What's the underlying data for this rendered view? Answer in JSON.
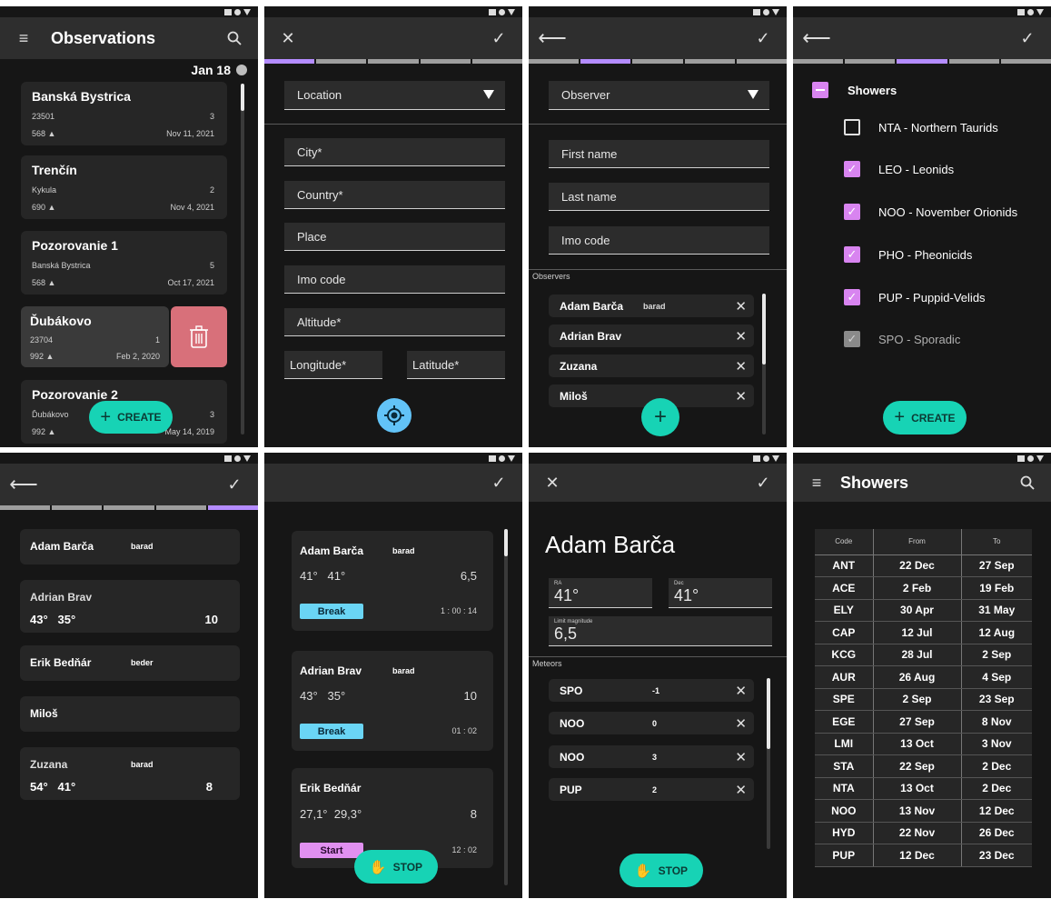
{
  "status_bar": {
    "label": ""
  },
  "s1": {
    "title": "Observations",
    "date_header": "Jan 18",
    "items": [
      {
        "name": "Banská Bystrica",
        "sub": "23501",
        "count": "3",
        "alt": "568",
        "date": "Nov 11, 2021"
      },
      {
        "name": "Trenčín",
        "sub": "Kykula",
        "count": "2",
        "alt": "690",
        "date": "Nov 4, 2021"
      },
      {
        "name": "Pozorovanie 1",
        "sub": "Banská Bystrica",
        "count": "5",
        "alt": "568",
        "date": "Oct 17, 2021"
      },
      {
        "name": "Ďubákovo",
        "sub": "23704",
        "count": "1",
        "alt": "992",
        "date": "Feb 2, 2020"
      },
      {
        "name": "Pozorovanie 2",
        "sub": "Ďubákovo",
        "count": "3",
        "alt": "992",
        "date": "May 14, 2019"
      }
    ],
    "create_label": "CREATE"
  },
  "s2": {
    "dropdown": "Location",
    "fields": [
      "City*",
      "Country*",
      "Place",
      "Imo code",
      "Altitude*"
    ],
    "longitude": "Longitude*",
    "latitude": "Latitude*"
  },
  "s3": {
    "dropdown": "Observer",
    "fields": [
      "First name",
      "Last name",
      "Imo code"
    ],
    "section_label": "Observers",
    "observers": [
      {
        "name": "Adam Barča",
        "code": "barad"
      },
      {
        "name": "Adrian Brav",
        "code": ""
      },
      {
        "name": "Zuzana",
        "code": ""
      },
      {
        "name": "Miloš",
        "code": ""
      }
    ]
  },
  "s4": {
    "group": "Showers",
    "items": [
      {
        "label": "NTA - Northern Taurids",
        "state": "unchecked"
      },
      {
        "label": "LEO - Leonids",
        "state": "checked"
      },
      {
        "label": "NOO - November Orionids",
        "state": "checked"
      },
      {
        "label": "PHO - Pheonicids",
        "state": "checked"
      },
      {
        "label": "PUP - Puppid-Velids",
        "state": "checked"
      },
      {
        "label": "SPO - Sporadic",
        "state": "disabled"
      }
    ],
    "create_label": "CREATE"
  },
  "s5": {
    "items": [
      {
        "name": "Adam Barča",
        "code": "barad",
        "coords": "",
        "value": ""
      },
      {
        "name": "Adrian Brav",
        "code": "",
        "coords": "43°   35°",
        "value": "10"
      },
      {
        "name": "Erik Bedňár",
        "code": "beder",
        "coords": "",
        "value": ""
      },
      {
        "name": "Miloš",
        "code": "",
        "coords": "",
        "value": ""
      },
      {
        "name": "Zuzana",
        "code": "barad",
        "coords": "54°   41°",
        "value": "8"
      }
    ]
  },
  "s6": {
    "items": [
      {
        "name": "Adam Barča",
        "code": "barad",
        "coords": "41°   41°",
        "value": "6,5",
        "btn": "Break",
        "time": "1 : 00 : 14"
      },
      {
        "name": "Adrian Brav",
        "code": "barad",
        "coords": "43°   35°",
        "value": "10",
        "btn": "Break",
        "time": "01 : 02"
      },
      {
        "name": "Erik Bedňár",
        "code": "",
        "coords": "27,1°  29,3°",
        "value": "8",
        "btn": "Start",
        "time": "12 : 02"
      }
    ],
    "stop_label": "STOP"
  },
  "s7": {
    "name": "Adam Barča",
    "ra_label": "RA",
    "ra": "41°",
    "dec_label": "Dec",
    "dec": "41°",
    "lm_label": "Limit magnitude",
    "lm": "6,5",
    "section_label": "Meteors",
    "meteors": [
      {
        "code": "SPO",
        "value": "-1"
      },
      {
        "code": "NOO",
        "value": "0"
      },
      {
        "code": "NOO",
        "value": "3"
      },
      {
        "code": "PUP",
        "value": "2"
      }
    ],
    "stop_label": "STOP"
  },
  "s8": {
    "title": "Showers",
    "columns": [
      "Code",
      "From",
      "To"
    ],
    "rows": [
      [
        "ANT",
        "22 Dec",
        "27 Sep"
      ],
      [
        "ACE",
        "2 Feb",
        "19 Feb"
      ],
      [
        "ELY",
        "30 Apr",
        "31 May"
      ],
      [
        "CAP",
        "12 Jul",
        "12 Aug"
      ],
      [
        "KCG",
        "28 Jul",
        "2 Sep"
      ],
      [
        "AUR",
        "26 Aug",
        "4 Sep"
      ],
      [
        "SPE",
        "2 Sep",
        "23 Sep"
      ],
      [
        "EGE",
        "27 Sep",
        "8 Nov"
      ],
      [
        "LMI",
        "13 Oct",
        "3 Nov"
      ],
      [
        "STA",
        "22 Sep",
        "2 Dec"
      ],
      [
        "NTA",
        "13 Oct",
        "2 Dec"
      ],
      [
        "NOO",
        "13 Nov",
        "12 Dec"
      ],
      [
        "HYD",
        "22 Nov",
        "26 Dec"
      ],
      [
        "PUP",
        "12 Dec",
        "23 Dec"
      ]
    ]
  },
  "colors": {
    "accent": "#17d3b5",
    "purple": "#b48cff",
    "checkbox": "#d884f0",
    "break": "#6ad5f5",
    "start": "#e190f0",
    "delete": "#d8707a"
  }
}
